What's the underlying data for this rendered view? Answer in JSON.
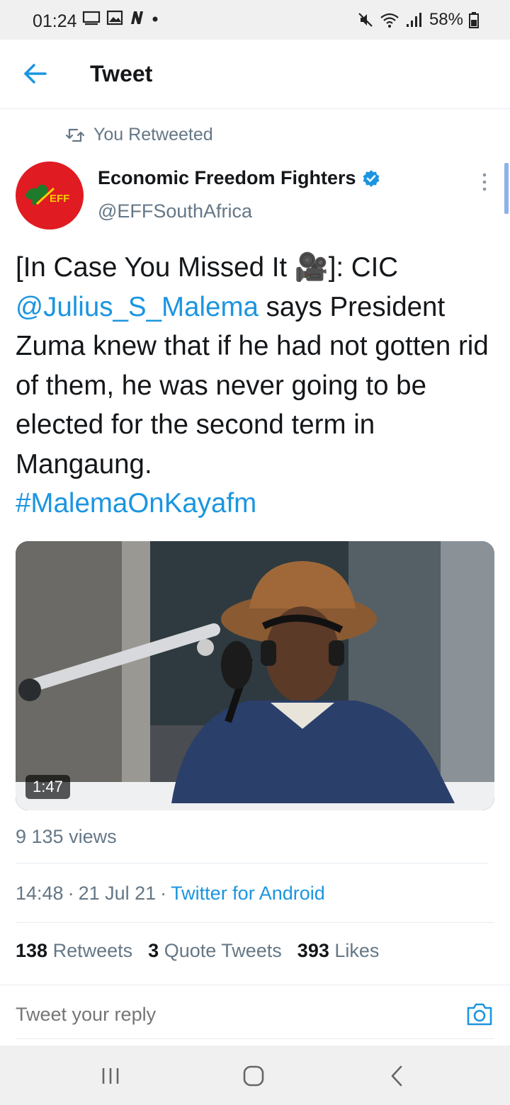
{
  "status_bar": {
    "time": "01:24",
    "battery": "58%",
    "icons": [
      "screen-icon",
      "gallery-icon",
      "news-icon",
      "dot-icon",
      "mute-icon",
      "wifi-icon",
      "signal-icon",
      "battery-icon"
    ]
  },
  "header": {
    "title": "Tweet"
  },
  "retweet_notice": "You Retweeted",
  "author": {
    "avatar_text": "EFF",
    "display_name": "Economic Freedom Fighters",
    "handle": "@EFFSouthAfrica",
    "verified": true
  },
  "tweet": {
    "part1": "[In Case You Missed It ",
    "emoji": "🎥",
    "part2": "]: CIC ",
    "mention": "@Julius_S_Malema",
    "part3": " says President Zuma knew that if he had not gotten rid of them, he was never going to be elected for the second term in Mangaung.",
    "hashtag": "#MalemaOnKayafm"
  },
  "media": {
    "duration": "1:47"
  },
  "views": "9 135 views",
  "meta": {
    "time": "14:48",
    "dot1": "·",
    "date": "21 Jul 21",
    "dot2": "·",
    "source": "Twitter for Android"
  },
  "stats": {
    "retweets_count": "138",
    "retweets_label": "Retweets",
    "quotes_count": "3",
    "quotes_label": "Quote Tweets",
    "likes_count": "393",
    "likes_label": "Likes"
  },
  "reply": {
    "placeholder": "Tweet your reply"
  },
  "colors": {
    "accent": "#1b95e0",
    "secondary_text": "#657786",
    "eff_red": "#e01b22"
  }
}
